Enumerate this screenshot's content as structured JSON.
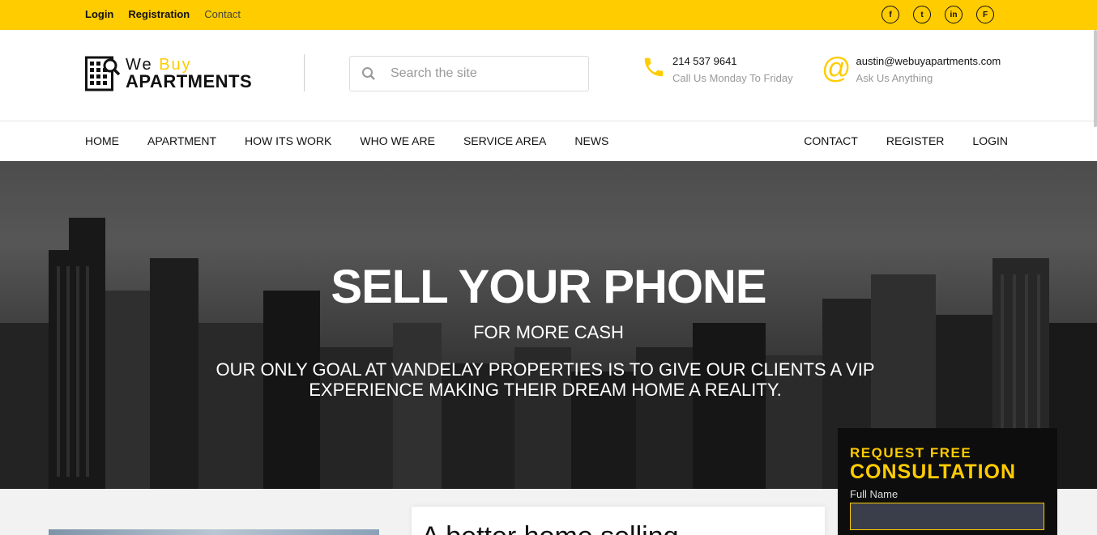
{
  "topbar": {
    "login": "Login",
    "registration": "Registration",
    "contact": "Contact",
    "social": [
      {
        "icon": "facebook-icon",
        "glyph": "f"
      },
      {
        "icon": "twitter-icon",
        "glyph": "t"
      },
      {
        "icon": "linkedin-icon",
        "glyph": "in"
      },
      {
        "icon": "foursquare-icon",
        "glyph": "F"
      }
    ]
  },
  "brand": {
    "line1_a": "We",
    "line1_b": "Buy",
    "line2": "APARTMENTS",
    "accent_color": "#ffcc00"
  },
  "search": {
    "placeholder": "Search the site",
    "value": ""
  },
  "phone": {
    "number": "214 537 9641",
    "note": "Call Us Monday To Friday",
    "icon": "phone-icon"
  },
  "email": {
    "address": "austin@webuyapartments.com",
    "note": "Ask Us Anything",
    "icon": "at-icon"
  },
  "nav": {
    "left": [
      "HOME",
      "APARTMENT",
      "HOW ITS WORK",
      "WHO WE ARE",
      "SERVICE AREA",
      "NEWS"
    ],
    "right": [
      "CONTACT",
      "REGISTER",
      "LOGIN"
    ]
  },
  "hero": {
    "title": "SELL YOUR PHONE",
    "subtitle": "FOR MORE CASH",
    "text": "OUR ONLY GOAL AT VANDELAY PROPERTIES IS TO GIVE OUR CLIENTS A VIP EXPERIENCE MAKING THEIR DREAM HOME A REALITY."
  },
  "consult": {
    "kicker": "REQUEST FREE",
    "heading": "CONSULTATION",
    "field_label": "Full Name",
    "field_value": ""
  },
  "section": {
    "heading": "A better home selling"
  }
}
